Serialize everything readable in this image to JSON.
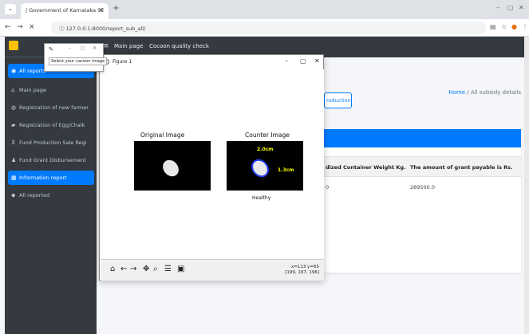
{
  "browser": {
    "tab_title": "| Government of Karnataka Sil",
    "tab_close": "×",
    "new_tab": "+",
    "url": "127.0.0.1:8000/report_sub_all/",
    "nav_back": "←",
    "nav_forward": "→",
    "nav_reload": "×",
    "win_min": "–",
    "win_max": "▢",
    "win_close": "✕"
  },
  "topnav": {
    "menu_icon": "≡",
    "links": [
      "Main page",
      "Cocoon quality check"
    ]
  },
  "sidebar": {
    "items": [
      {
        "label": "All reports",
        "icon": "dashboard-icon",
        "glyph": "◉"
      },
      {
        "label": "Main page",
        "icon": "home-icon",
        "glyph": "⌂"
      },
      {
        "label": "Registration of new farmer",
        "icon": "user-icon",
        "glyph": "◍"
      },
      {
        "label": "Registration of Egg/Chalk",
        "icon": "truck-icon",
        "glyph": "▰"
      },
      {
        "label": "Fund Production Sale Regi",
        "icon": "cart-icon",
        "glyph": "⊼"
      },
      {
        "label": "Fund Grant Disbursement",
        "icon": "person-icon",
        "glyph": "♟"
      },
      {
        "label": "Information report",
        "icon": "table-icon",
        "glyph": "▦"
      },
      {
        "label": "All reported",
        "icon": "tag-icon",
        "glyph": "◆"
      }
    ],
    "active_index": 6
  },
  "content": {
    "breadcrumb_home": "Home",
    "breadcrumb_sep": " / ",
    "breadcrumb_current": "All subsidy details",
    "tab_button": "roduction",
    "col_headers": [
      "dized Container Weight Kg.",
      "The amount of grant payable is Rs."
    ],
    "row_values": [
      "0",
      "289500.0"
    ]
  },
  "dialog": {
    "label": "Select your cacoon image",
    "controls": [
      "–",
      "▢",
      "✕"
    ]
  },
  "figure": {
    "title": "Figure 1",
    "controls": [
      "–",
      "▢",
      "✕"
    ],
    "left_title": "Original Image",
    "right_title": "Counter Image",
    "dim_top": "2.0cm",
    "dim_right": "1.3cm",
    "status": "Healthy",
    "coord_line1": "x=113 y=65",
    "coord_line2": "[199, 197, 196]",
    "toolbar": [
      {
        "icon": "home-icon",
        "glyph": "⌂"
      },
      {
        "icon": "back-arrow-icon",
        "glyph": "←"
      },
      {
        "icon": "forward-arrow-icon",
        "glyph": "→"
      },
      {
        "icon": "pan-icon",
        "glyph": "✥"
      },
      {
        "icon": "zoom-icon",
        "glyph": "⌕"
      },
      {
        "icon": "configure-icon",
        "glyph": "☰"
      },
      {
        "icon": "save-icon",
        "glyph": "▣"
      }
    ]
  },
  "colors": {
    "accent": "#007bff",
    "sidebar": "#343a40",
    "success": "#28a745",
    "measure_text": "#ffff00"
  }
}
